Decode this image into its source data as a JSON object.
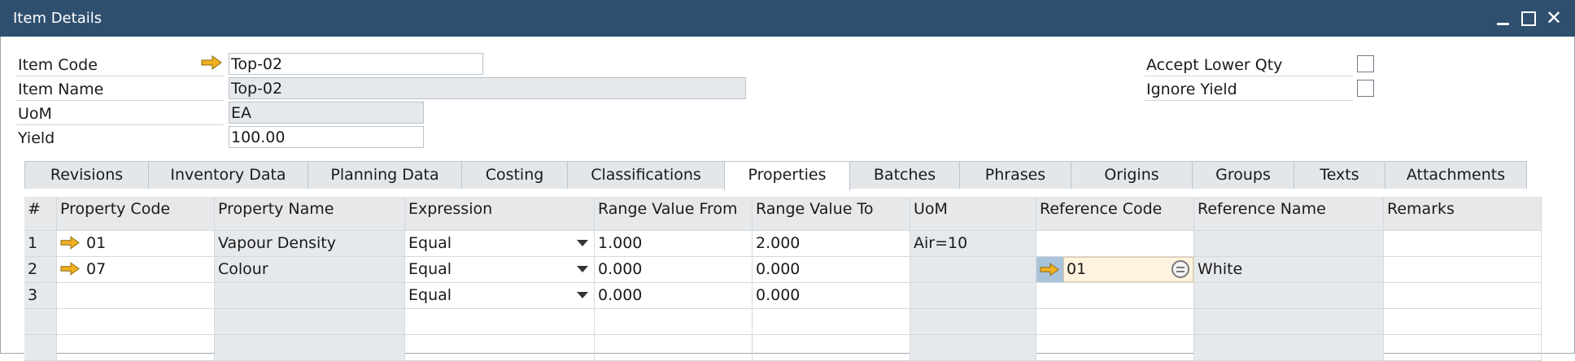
{
  "window": {
    "title": "Item Details"
  },
  "header": {
    "item_code_label": "Item Code",
    "item_code_value": "Top-02",
    "item_name_label": "Item Name",
    "item_name_value": "Top-02",
    "uom_label": "UoM",
    "uom_value": "EA",
    "yield_label": "Yield",
    "yield_value": "100.00",
    "accept_lower_qty_label": "Accept Lower Qty",
    "accept_lower_qty_checked": false,
    "ignore_yield_label": "Ignore Yield",
    "ignore_yield_checked": false
  },
  "tabs": [
    {
      "label": "Revisions"
    },
    {
      "label": "Inventory Data"
    },
    {
      "label": "Planning Data"
    },
    {
      "label": "Costing"
    },
    {
      "label": "Classifications"
    },
    {
      "label": "Properties",
      "active": true
    },
    {
      "label": "Batches"
    },
    {
      "label": "Phrases"
    },
    {
      "label": "Origins"
    },
    {
      "label": "Groups"
    },
    {
      "label": "Texts"
    },
    {
      "label": "Attachments"
    }
  ],
  "grid": {
    "columns": [
      "#",
      "Property Code",
      "Property Name",
      "Expression",
      "Range Value From",
      "Range Value To",
      "UoM",
      "Reference Code",
      "Reference Name",
      "Remarks"
    ],
    "rows": [
      {
        "num": "1",
        "property_code": "01",
        "property_name": "Vapour Density",
        "expression": "Equal",
        "range_from": "1.000",
        "range_to": "2.000",
        "uom": "Air=10",
        "reference_code": "",
        "reference_name": "",
        "remarks": ""
      },
      {
        "num": "2",
        "property_code": "07",
        "property_name": "Colour",
        "expression": "Equal",
        "range_from": "0.000",
        "range_to": "0.000",
        "uom": "",
        "reference_code": "01",
        "reference_name": "White",
        "remarks": ""
      },
      {
        "num": "3",
        "property_code": "",
        "property_name": "",
        "expression": "Equal",
        "range_from": "0.000",
        "range_to": "0.000",
        "uom": "",
        "reference_code": "",
        "reference_name": "",
        "remarks": ""
      }
    ]
  },
  "colors": {
    "titlebar": "#2f4f6f",
    "link_arrow": "#f0b020",
    "readonly_field": "#e6e9ec"
  },
  "icons": {
    "link_arrow": "arrow-right-icon",
    "reference_lookup": "list-lookup-icon"
  }
}
